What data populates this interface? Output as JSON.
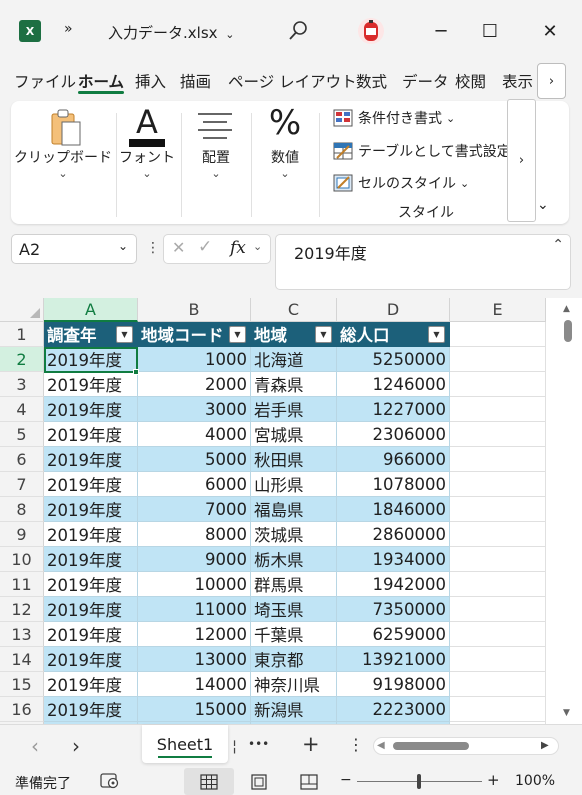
{
  "titlebar": {
    "app_icon": "excel-logo",
    "app_icon_text": "X",
    "overflow": "»",
    "filename": "入力データ.xlsx",
    "search_icon": "search-icon",
    "minimize": "─",
    "maximize": "☐",
    "close": "✕"
  },
  "tabs": [
    "ファイル",
    "ホーム",
    "挿入",
    "描画",
    "ページ レイアウト",
    "数式",
    "データ",
    "校閲",
    "表示"
  ],
  "active_tab": "ホーム",
  "tabs_more": "›",
  "ribbon": {
    "clipboard": "クリップボード",
    "font": "フォント",
    "font_glyph": "A",
    "alignment": "配置",
    "number": "数値",
    "number_glyph": "%",
    "conditional_format": "条件付き書式",
    "format_as_table": "テーブルとして書式設定",
    "cell_styles": "セルのスタイル",
    "styles_group": "スタイル",
    "more": "›",
    "expand": "⌄"
  },
  "formula_bar": {
    "name_box": "A2",
    "fx": "fx",
    "value": "2019年度"
  },
  "columns": [
    "A",
    "B",
    "C",
    "D",
    "E"
  ],
  "header_row": [
    "調査年",
    "地域コード",
    "地域",
    "総人口"
  ],
  "rows": [
    [
      "2019年度",
      "1000",
      "北海道",
      "5250000"
    ],
    [
      "2019年度",
      "2000",
      "青森県",
      "1246000"
    ],
    [
      "2019年度",
      "3000",
      "岩手県",
      "1227000"
    ],
    [
      "2019年度",
      "4000",
      "宮城県",
      "2306000"
    ],
    [
      "2019年度",
      "5000",
      "秋田県",
      "966000"
    ],
    [
      "2019年度",
      "6000",
      "山形県",
      "1078000"
    ],
    [
      "2019年度",
      "7000",
      "福島県",
      "1846000"
    ],
    [
      "2019年度",
      "8000",
      "茨城県",
      "2860000"
    ],
    [
      "2019年度",
      "9000",
      "栃木県",
      "1934000"
    ],
    [
      "2019年度",
      "10000",
      "群馬県",
      "1942000"
    ],
    [
      "2019年度",
      "11000",
      "埼玉県",
      "7350000"
    ],
    [
      "2019年度",
      "12000",
      "千葉県",
      "6259000"
    ],
    [
      "2019年度",
      "13000",
      "東京都",
      "13921000"
    ],
    [
      "2019年度",
      "14000",
      "神奈川県",
      "9198000"
    ],
    [
      "2019年度",
      "15000",
      "新潟県",
      "2223000"
    ]
  ],
  "row_numbers": [
    "1",
    "2",
    "3",
    "4",
    "5",
    "6",
    "7",
    "8",
    "9",
    "10",
    "11",
    "12",
    "13",
    "14",
    "15",
    "16"
  ],
  "sheet_bar": {
    "prev": "‹",
    "next": "›",
    "sheet_name": "Sheet1",
    "more": "•••",
    "add": "+",
    "menu": "⋮",
    "scroll_left": "◀",
    "scroll_right": "▶"
  },
  "status_bar": {
    "ready": "準備完了",
    "zoom_minus": "−",
    "zoom_plus": "+",
    "zoom": "100%"
  },
  "colors": {
    "header_fill": "#1c607a",
    "band_fill": "#c0e4f5",
    "accent": "#107c41"
  }
}
